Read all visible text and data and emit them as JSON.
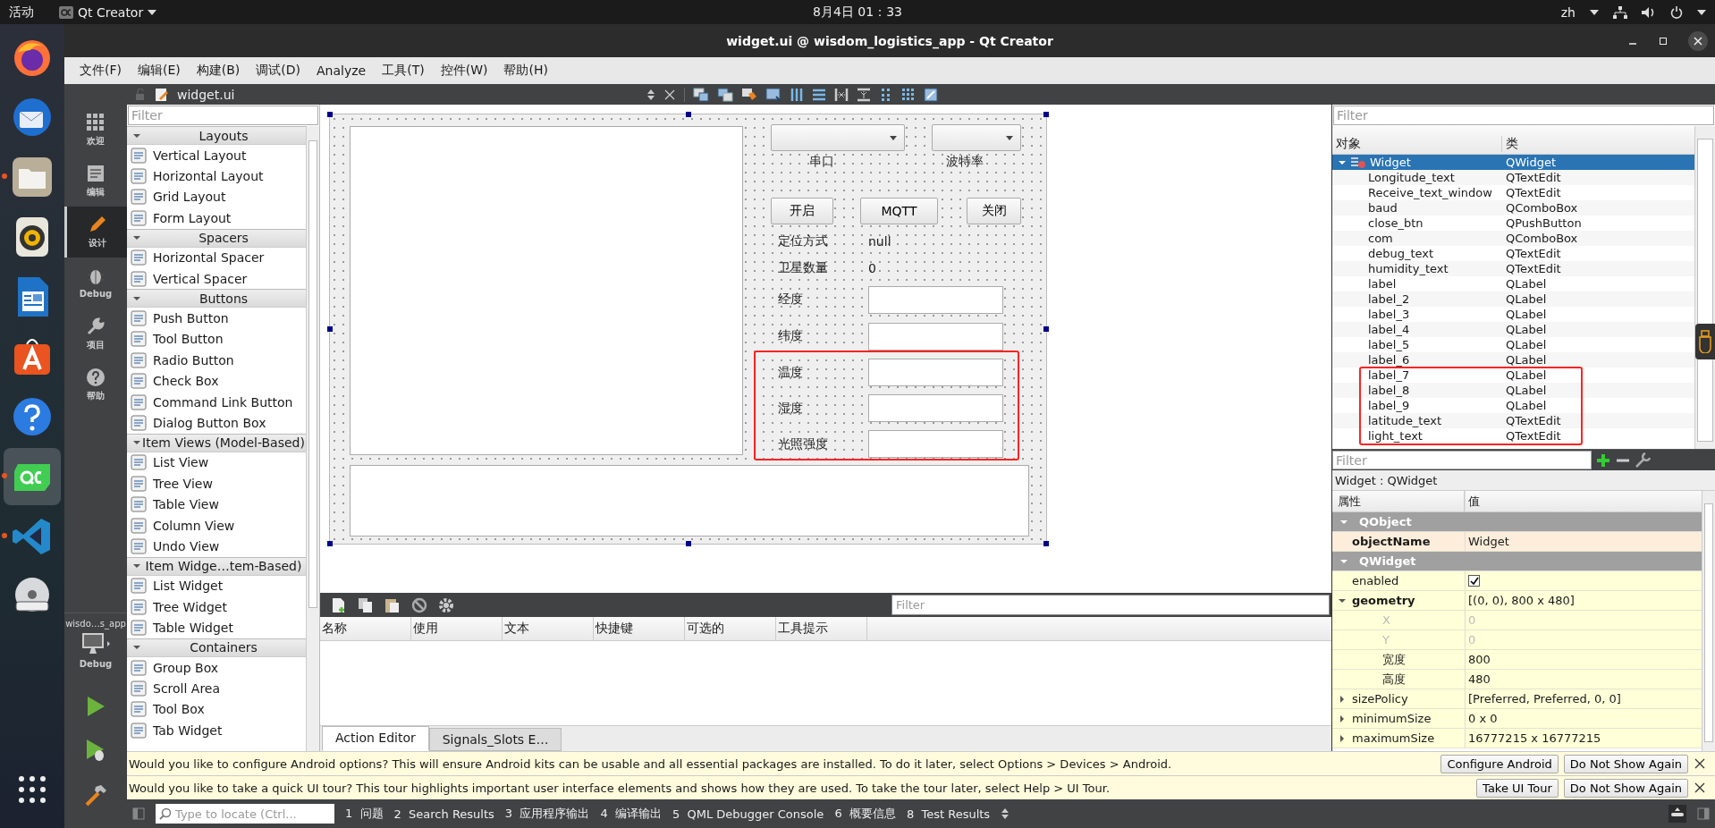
{
  "top_bar": {
    "activities": "活动",
    "app_menu": "Qt Creator",
    "clock": "8月4日 01：33",
    "input_method": "zh"
  },
  "dock": {
    "apps": [
      {
        "kind": "browser",
        "running": false,
        "selected": false
      },
      {
        "kind": "mail",
        "running": false,
        "selected": false
      },
      {
        "kind": "files",
        "running": true,
        "selected": false
      },
      {
        "kind": "music",
        "running": false,
        "selected": false
      },
      {
        "kind": "writer",
        "running": false,
        "selected": false
      },
      {
        "kind": "store",
        "running": false,
        "selected": false
      },
      {
        "kind": "help",
        "running": false,
        "selected": false
      },
      {
        "kind": "qt",
        "running": true,
        "selected": true
      },
      {
        "kind": "code",
        "running": true,
        "selected": false
      },
      {
        "kind": "disc",
        "running": false,
        "selected": false
      }
    ]
  },
  "window": {
    "title": "widget.ui @ wisdom_logistics_app - Qt Creator"
  },
  "menu": [
    "文件(F)",
    "编辑(E)",
    "构建(B)",
    "调试(D)",
    "Analyze",
    "工具(T)",
    "控件(W)",
    "帮助(H)"
  ],
  "modes": [
    {
      "label": "欢迎",
      "kind": "grid",
      "selected": false
    },
    {
      "label": "编辑",
      "kind": "doc",
      "selected": false
    },
    {
      "label": "设计",
      "kind": "pencil",
      "selected": true
    },
    {
      "label": "Debug",
      "kind": "bug",
      "selected": false
    },
    {
      "label": "项目",
      "kind": "wrench",
      "selected": false
    },
    {
      "label": "帮助",
      "kind": "help",
      "selected": false
    }
  ],
  "kit": {
    "project": "wisdo…s_app",
    "build": "Debug"
  },
  "editor_toolbar": {
    "file": "widget.ui"
  },
  "widget_box": {
    "filter_placeholder": "Filter",
    "groups": [
      {
        "title": "Layouts",
        "expanded": true,
        "items": [
          "Vertical Layout",
          "Horizontal Layout",
          "Grid Layout",
          "Form Layout"
        ]
      },
      {
        "title": "Spacers",
        "expanded": true,
        "items": [
          "Horizontal Spacer",
          "Vertical Spacer"
        ]
      },
      {
        "title": "Buttons",
        "expanded": true,
        "items": [
          "Push Button",
          "Tool Button",
          "Radio Button",
          "Check Box",
          "Command Link Button",
          "Dialog Button Box"
        ]
      },
      {
        "title": "Item Views (Model-Based)",
        "expanded": true,
        "items": [
          "List View",
          "Tree View",
          "Table View",
          "Column View",
          "Undo View"
        ]
      },
      {
        "title": "Item Widge…tem-Based)",
        "expanded": true,
        "items": [
          "List Widget",
          "Tree Widget",
          "Table Widget"
        ]
      },
      {
        "title": "Containers",
        "expanded": true,
        "items": [
          "Group Box",
          "Scroll Area",
          "Tool Box",
          "Tab Widget"
        ]
      }
    ]
  },
  "form": {
    "highlight_box": true,
    "widgets": [
      {
        "kind": "text_edit"
      },
      {
        "kind": "combo_box"
      },
      {
        "kind": "combo_box"
      },
      {
        "kind": "label",
        "text": "串口"
      },
      {
        "kind": "label",
        "text": "波特率"
      },
      {
        "kind": "button",
        "text": "开启"
      },
      {
        "kind": "button",
        "text": "MQTT"
      },
      {
        "kind": "button",
        "text": "关闭"
      },
      {
        "kind": "label",
        "text": "定位方式"
      },
      {
        "kind": "label",
        "text": "null"
      },
      {
        "kind": "label",
        "text": "卫星数量"
      },
      {
        "kind": "label",
        "text": "0"
      },
      {
        "kind": "label",
        "text": "经度"
      },
      {
        "kind": "text_edit"
      },
      {
        "kind": "label",
        "text": "纬度"
      },
      {
        "kind": "text_edit"
      },
      {
        "kind": "label",
        "text": "温度"
      },
      {
        "kind": "text_edit"
      },
      {
        "kind": "label",
        "text": "湿度"
      },
      {
        "kind": "text_edit"
      },
      {
        "kind": "label",
        "text": "光照强度"
      },
      {
        "kind": "text_edit"
      },
      {
        "kind": "text_edit"
      }
    ]
  },
  "action_editor": {
    "filter_placeholder": "Filter",
    "columns": [
      "名称",
      "使用",
      "文本",
      "快捷键",
      "可选的",
      "工具提示"
    ],
    "tabs": [
      {
        "label": "Action Editor",
        "selected": true
      },
      {
        "label": "Signals_Slots E…",
        "selected": false
      }
    ]
  },
  "object_inspector": {
    "highlight_box": true,
    "filter_placeholder": "Filter",
    "columns": [
      "对象",
      "类"
    ],
    "tree": [
      {
        "name": "Widget",
        "class": "QWidget",
        "selected": true,
        "expanded": true,
        "children": [
          {
            "name": "Longitude_text",
            "class": "QTextEdit",
            "selected": false
          },
          {
            "name": "Receive_text_window",
            "class": "QTextEdit",
            "selected": false
          },
          {
            "name": "baud",
            "class": "QComboBox",
            "selected": false
          },
          {
            "name": "close_btn",
            "class": "QPushButton",
            "selected": false
          },
          {
            "name": "com",
            "class": "QComboBox",
            "selected": false
          },
          {
            "name": "debug_text",
            "class": "QTextEdit",
            "selected": false
          },
          {
            "name": "humidity_text",
            "class": "QTextEdit",
            "selected": false
          },
          {
            "name": "label",
            "class": "QLabel",
            "selected": false
          },
          {
            "name": "label_2",
            "class": "QLabel",
            "selected": false
          },
          {
            "name": "label_3",
            "class": "QLabel",
            "selected": false
          },
          {
            "name": "label_4",
            "class": "QLabel",
            "selected": false
          },
          {
            "name": "label_5",
            "class": "QLabel",
            "selected": false
          },
          {
            "name": "label_6",
            "class": "QLabel",
            "selected": false
          },
          {
            "name": "label_7",
            "class": "QLabel",
            "selected": false
          },
          {
            "name": "label_8",
            "class": "QLabel",
            "selected": false
          },
          {
            "name": "label_9",
            "class": "QLabel",
            "selected": false
          },
          {
            "name": "latitude_text",
            "class": "QTextEdit",
            "selected": false
          },
          {
            "name": "light_text",
            "class": "QTextEdit",
            "selected": false
          }
        ]
      }
    ]
  },
  "property_editor": {
    "filter_placeholder": "Filter",
    "object_label": "Widget : QWidget",
    "columns": [
      "属性",
      "值"
    ],
    "sections": [
      {
        "name": "QObject",
        "color": "#fdeedb",
        "expanded": true,
        "properties": [
          {
            "name": "objectName",
            "value": "Widget",
            "kind": "text",
            "modified": true,
            "disabled": false
          }
        ]
      },
      {
        "name": "QWidget",
        "color": "#ffffd8",
        "expanded": true,
        "properties": [
          {
            "name": "enabled",
            "kind": "checkbox",
            "checked": true,
            "modified": false,
            "disabled": false
          },
          {
            "name": "geometry",
            "value": "[(0, 0), 800 x 480]",
            "kind": "text",
            "modified": true,
            "disabled": false,
            "expanded": true,
            "children": [
              {
                "name": "X",
                "value": "0",
                "kind": "text",
                "modified": false,
                "disabled": true
              },
              {
                "name": "Y",
                "value": "0",
                "kind": "text",
                "modified": false,
                "disabled": true
              },
              {
                "name": "宽度",
                "value": "800",
                "kind": "text",
                "modified": false,
                "disabled": false
              },
              {
                "name": "高度",
                "value": "480",
                "kind": "text",
                "modified": false,
                "disabled": false
              }
            ]
          },
          {
            "name": "sizePolicy",
            "value": "[Preferred, Preferred, 0, 0]",
            "kind": "text",
            "modified": false,
            "disabled": false,
            "expanded": false
          },
          {
            "name": "minimumSize",
            "value": "0 x 0",
            "kind": "text",
            "modified": false,
            "disabled": false,
            "expanded": false
          },
          {
            "name": "maximumSize",
            "value": "16777215 x 16777215",
            "kind": "text",
            "modified": false,
            "disabled": false,
            "expanded": false
          }
        ]
      }
    ]
  },
  "info_bars": [
    {
      "message": "Would you like to configure Android options? This will ensure Android kits can be usable and all essential packages are installed. To do it later, select Options > Devices > Android.",
      "buttons": [
        "Configure Android",
        "Do Not Show Again"
      ]
    },
    {
      "message": "Would you like to take a quick UI tour? This tour highlights important user interface elements and shows how they are used. To take the tour later, select Help > UI Tour.",
      "buttons": [
        "Take UI Tour",
        "Do Not Show Again"
      ]
    }
  ],
  "status_bar": {
    "locate_placeholder": "Type to locate (Ctrl...",
    "panes": [
      {
        "number": "1",
        "label": "问题"
      },
      {
        "number": "2",
        "label": "Search Results"
      },
      {
        "number": "3",
        "label": "应用程序输出"
      },
      {
        "number": "4",
        "label": "编译输出"
      },
      {
        "number": "5",
        "label": "QML Debugger Console"
      },
      {
        "number": "6",
        "label": "概要信息"
      },
      {
        "number": "8",
        "label": "Test Results"
      }
    ]
  }
}
